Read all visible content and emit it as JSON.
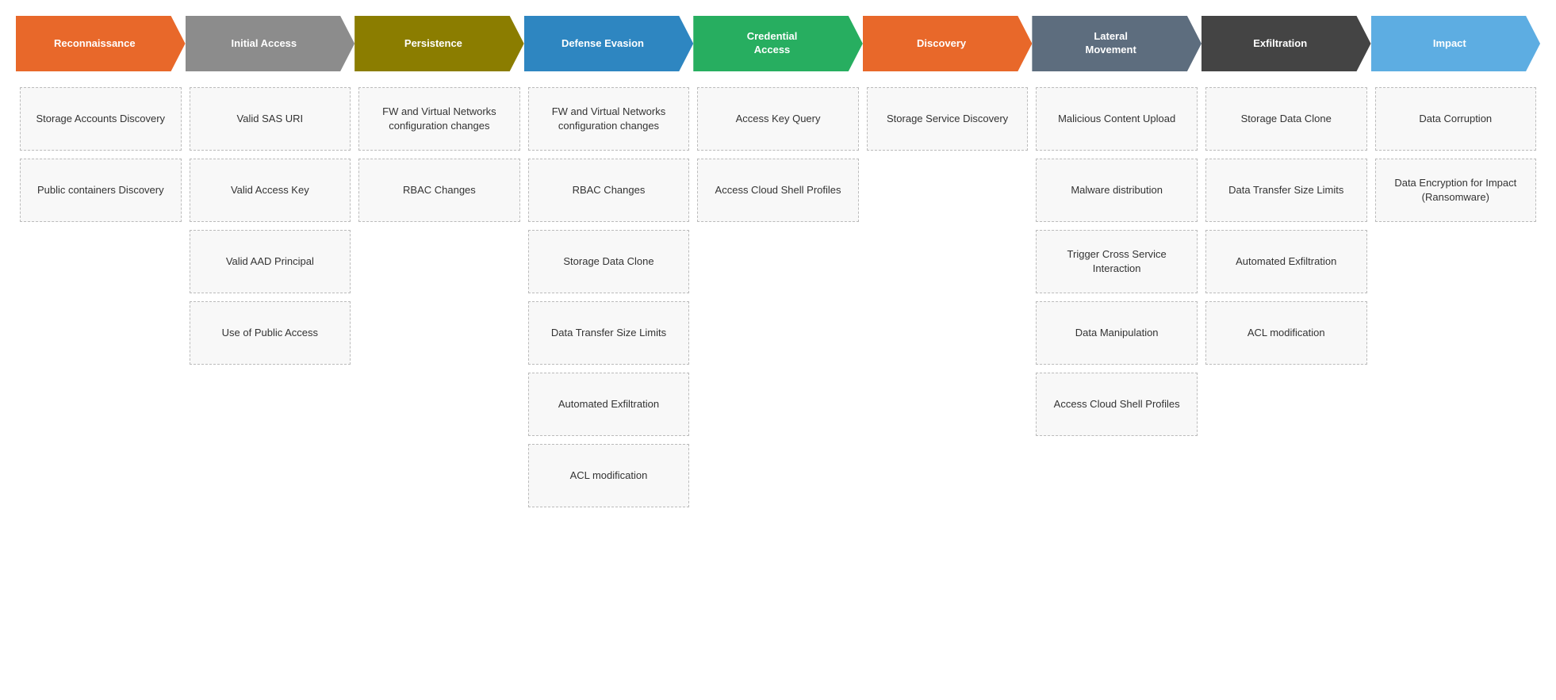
{
  "header": {
    "columns": [
      {
        "id": "recon",
        "label": "Reconnaissance",
        "color": "color-orange"
      },
      {
        "id": "initial",
        "label": "Initial Access",
        "color": "color-gray"
      },
      {
        "id": "persist",
        "label": "Persistence",
        "color": "color-olive"
      },
      {
        "id": "defense",
        "label": "Defense Evasion",
        "color": "color-blue"
      },
      {
        "id": "cred",
        "label": "Credential\nAccess",
        "color": "color-green"
      },
      {
        "id": "discovery",
        "label": "Discovery",
        "color": "color-orange2"
      },
      {
        "id": "lateral",
        "label": "Lateral\nMovement",
        "color": "color-darkgray"
      },
      {
        "id": "exfil",
        "label": "Exfiltration",
        "color": "color-charcoal"
      },
      {
        "id": "impact",
        "label": "Impact",
        "color": "color-skyblue"
      }
    ]
  },
  "columns": {
    "recon": [
      "Storage Accounts Discovery",
      "Public containers Discovery"
    ],
    "initial": [
      "Valid SAS URI",
      "Valid Access Key",
      "Valid AAD Principal",
      "Use of Public Access"
    ],
    "persist": [
      "FW and Virtual Networks configuration changes",
      "RBAC Changes"
    ],
    "defense": [
      "FW and Virtual Networks configuration changes",
      "RBAC Changes",
      "Storage Data Clone",
      "Data Transfer Size Limits",
      "Automated Exfiltration",
      "ACL modification"
    ],
    "cred": [
      "Access Key Query",
      "Access Cloud Shell Profiles"
    ],
    "discovery": [
      "Storage Service Discovery"
    ],
    "lateral": [
      "Malicious Content Upload",
      "Malware distribution",
      "Trigger Cross Service Interaction",
      "Data Manipulation",
      "Access Cloud Shell Profiles"
    ],
    "exfil": [
      "Storage Data Clone",
      "Data Transfer Size Limits",
      "Automated Exfiltration",
      "ACL modification"
    ],
    "impact": [
      "Data Corruption",
      "Data Encryption for Impact (Ransomware)"
    ]
  }
}
